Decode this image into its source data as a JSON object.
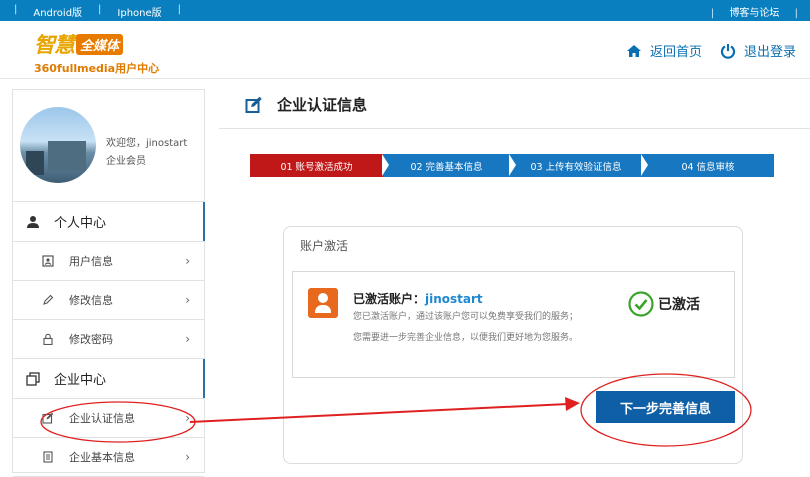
{
  "topbar": {
    "links_left": [
      "Android版",
      "Iphone版"
    ],
    "link_right": "博客与论坛"
  },
  "header": {
    "logo_zh1": "智慧",
    "logo_zh2": "全媒体",
    "logo_sub": "360fullmedia用户中心",
    "home_label": "返回首页",
    "logout_label": "退出登录"
  },
  "sidebar": {
    "welcome": "欢迎您，jinostart",
    "member_type": "企业会员",
    "personal_center": "个人中心",
    "personal_items": [
      {
        "label": "用户信息",
        "icon": "id-card-icon"
      },
      {
        "label": "修改信息",
        "icon": "pencil-icon"
      },
      {
        "label": "修改密码",
        "icon": "lock-icon"
      }
    ],
    "enterprise_center": "企业中心",
    "enterprise_items": [
      {
        "label": "企业认证信息",
        "icon": "edit-icon"
      },
      {
        "label": "企业基本信息",
        "icon": "document-icon"
      }
    ]
  },
  "main": {
    "title": "企业认证信息",
    "steps": [
      "01 账号激活成功",
      "02 完善基本信息",
      "03 上传有效验证信息",
      "04 信息审核"
    ],
    "panel_title": "账户激活",
    "activated_prefix": "已激活账户：",
    "username": "jinostart",
    "desc1": "您已激活账户，通过该账户您可以免费享受我们的服务；",
    "desc2": "您需要进一步完善企业信息，以便我们更好地为您服务。",
    "status": "已激活",
    "next_button": "下一步完善信息"
  },
  "colors": {
    "topbar": "#0a7fbf",
    "step_active": "#c01818",
    "step_inactive": "#1777c0",
    "primary_button": "#0f5fa6",
    "annotation": "#e02020"
  }
}
